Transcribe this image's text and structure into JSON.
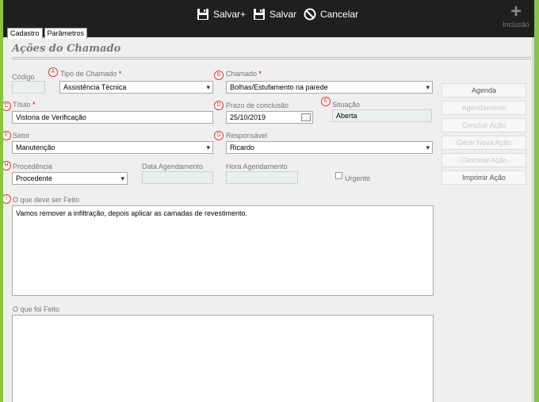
{
  "toolbar": {
    "salvar_plus_label": "Salvar+",
    "salvar_label": "Salvar",
    "cancelar_label": "Cancelar",
    "inclusao_label": "Inclusão"
  },
  "tabs": [
    {
      "label": "Cadastro"
    },
    {
      "label": "Parâmetros"
    }
  ],
  "section_title": "Ações do Chamado",
  "markers": {
    "a": "A",
    "b": "B",
    "c": "C",
    "d": "D",
    "e": "E",
    "f": "F",
    "g": "G",
    "h": "H",
    "i": "I"
  },
  "form": {
    "codigo": {
      "label": "Código",
      "value": ""
    },
    "tipo_chamado": {
      "label": "Tipo de Chamado",
      "required": "*",
      "value": "Assistência Técnica"
    },
    "chamado": {
      "label": "Chamado",
      "required": "*",
      "value": "Bolhas/Estufamento na parede"
    },
    "titulo": {
      "label": "Título",
      "required": "*",
      "value": "Vistoria de Verificação"
    },
    "prazo": {
      "label": "Prazo de conclusão",
      "value": "25/10/2019"
    },
    "situacao": {
      "label": "Situação",
      "value": "Aberta"
    },
    "setor": {
      "label": "Setor",
      "value": "Manutenção"
    },
    "responsavel": {
      "label": "Responsável",
      "value": "Ricardo"
    },
    "procedencia": {
      "label": "Procedência",
      "value": "Procedente"
    },
    "data_agendamento": {
      "label": "Data Agendamento",
      "value": ""
    },
    "hora_agendamento": {
      "label": "Hora Agendamento",
      "value": ""
    },
    "urgente": {
      "label": "Urgente",
      "checked": false
    },
    "o_que_deve": {
      "label": "O que deve ser Feito",
      "value": "Vamos remover a infiltração, depois aplicar as camadas de revestimento."
    },
    "o_que_foi": {
      "label": "O que foi Feito",
      "value": ""
    }
  },
  "side_buttons": [
    {
      "label": "Agenda",
      "enabled": true
    },
    {
      "label": "Agendamento",
      "enabled": false
    },
    {
      "label": "Concluir Ação",
      "enabled": false
    },
    {
      "label": "Gerar Nova Ação",
      "enabled": false
    },
    {
      "label": "Cancelar Ação",
      "enabled": false
    },
    {
      "label": "Imprimir Ação",
      "enabled": true
    }
  ]
}
